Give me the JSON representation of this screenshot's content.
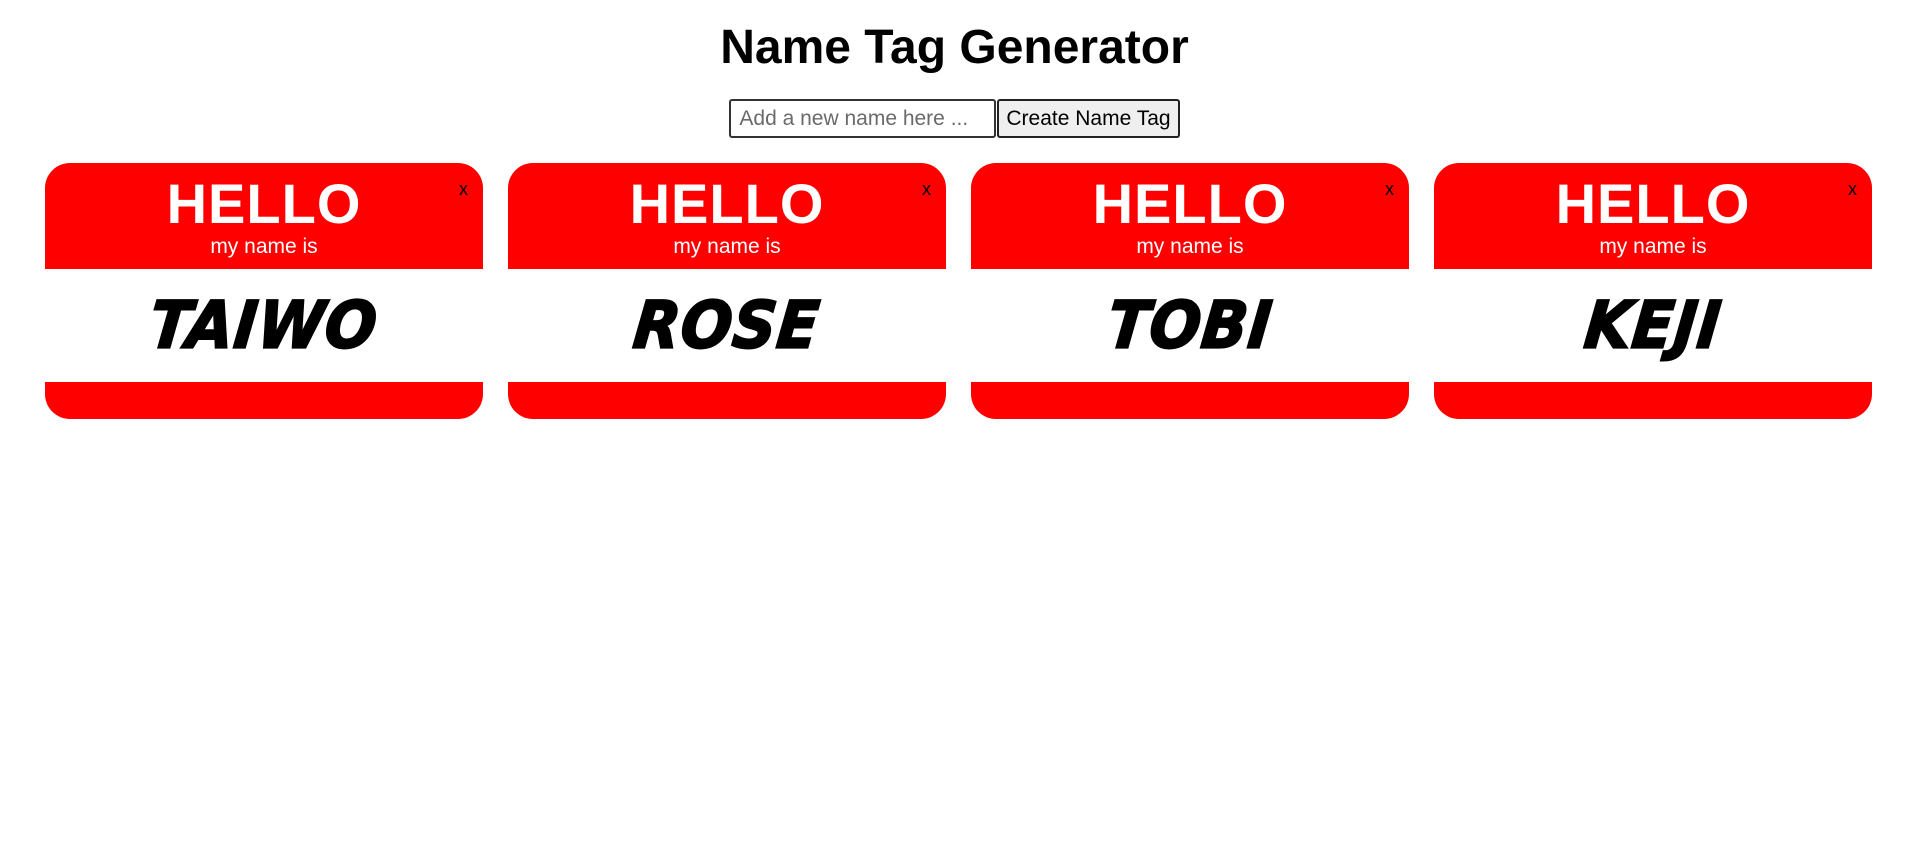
{
  "page": {
    "title": "Name Tag Generator"
  },
  "form": {
    "input_value": "",
    "input_placeholder": "Add a new name here ...",
    "button_label": "Create Name Tag"
  },
  "tags": [
    {
      "hello": "HELLO",
      "subtitle": "my name is",
      "name": "TAIWO",
      "close_label": "x"
    },
    {
      "hello": "HELLO",
      "subtitle": "my name is",
      "name": "ROSE",
      "close_label": "x"
    },
    {
      "hello": "HELLO",
      "subtitle": "my name is",
      "name": "TOBI",
      "close_label": "x"
    },
    {
      "hello": "HELLO",
      "subtitle": "my name is",
      "name": "KEJI",
      "close_label": "x"
    }
  ],
  "colors": {
    "tag_red": "#ff0000",
    "tag_white": "#ffffff",
    "text": "#000000"
  }
}
